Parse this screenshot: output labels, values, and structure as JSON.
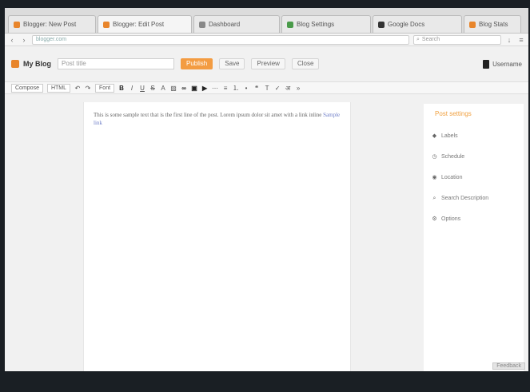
{
  "browser": {
    "tabs": [
      {
        "label": "Blogger: New Post",
        "color": "#e8852b",
        "active": false
      },
      {
        "label": "Blogger: Edit Post",
        "color": "#e8852b",
        "active": true
      },
      {
        "label": "Dashboard",
        "color": "#888888",
        "active": false
      },
      {
        "label": "Blog Settings",
        "color": "#4a9b4a",
        "active": false
      },
      {
        "label": "Google Docs",
        "color": "#333333",
        "active": false
      },
      {
        "label": "Blog Stats",
        "color": "#e8852b",
        "active": false
      }
    ],
    "url": "blogger.com",
    "search_placeholder": "Search"
  },
  "app": {
    "brand": "My Blog",
    "post_title_placeholder": "Post title",
    "buttons": {
      "publish": "Publish",
      "save": "Save",
      "preview": "Preview",
      "close": "Close"
    },
    "user_name": "Username"
  },
  "toolbar": {
    "compose_label": "Compose",
    "html_label": "HTML",
    "font_label": "Font"
  },
  "editor": {
    "body_text": "This is some sample text that is the first line of the post. Lorem ipsum dolor sit amet with a link inline",
    "link_text": "Sample link"
  },
  "sidebar": {
    "title": "Post settings",
    "items": [
      {
        "label": "Labels",
        "icon": "tag-icon"
      },
      {
        "label": "Schedule",
        "icon": "clock-icon"
      },
      {
        "label": "Location",
        "icon": "location-icon"
      },
      {
        "label": "Search Description",
        "icon": "search-icon"
      },
      {
        "label": "Options",
        "icon": "gear-icon"
      }
    ]
  },
  "footer": {
    "corner_label": "Feedback"
  }
}
